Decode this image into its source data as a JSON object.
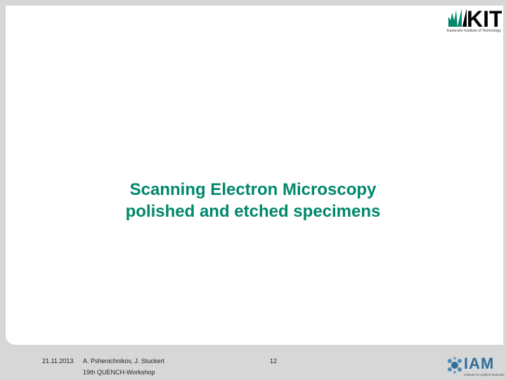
{
  "slide": {
    "title_line1": "Scanning Electron Microscopy",
    "title_line2": "polished and etched specimens"
  },
  "header": {
    "logo_text": "KIT",
    "logo_tagline": "Karlsruhe Institute of Technology"
  },
  "footer": {
    "date": "21.11.2013",
    "authors": "A. Pshenichnikov, J. Stuckert",
    "workshop": "19th QUENCH-Workshop",
    "page_number": "12",
    "iam_logo_text": "IAM",
    "iam_tagline": "Institute for Applied Materials"
  },
  "colors": {
    "title": "#00876c",
    "kit_green": "#00876c",
    "iam_blue": "#2f6f9a",
    "background": "#d7d7d7"
  }
}
